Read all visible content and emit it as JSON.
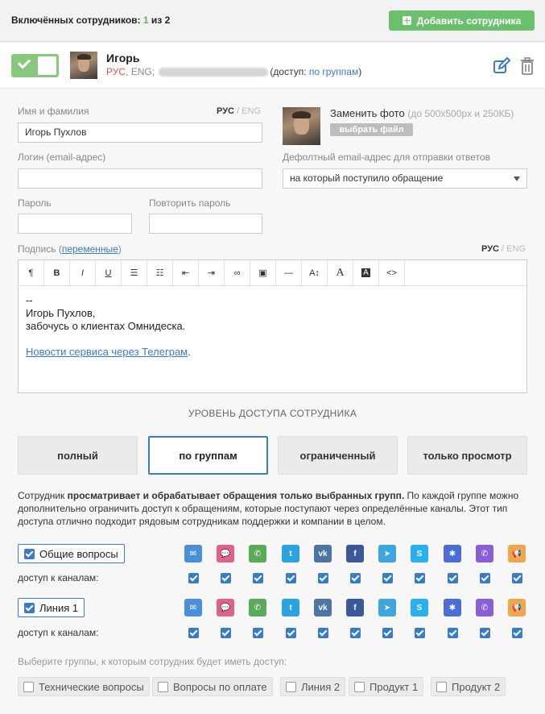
{
  "header": {
    "count_label": "Включённых сотрудников:",
    "count_active": "1",
    "count_sep": "из",
    "count_total": "2",
    "add_button": "Добавить сотрудника"
  },
  "employee": {
    "name": "Игорь",
    "lang_ru": "РУС",
    "lang_en": "ENG;",
    "access_prefix": "(доступ:",
    "access_value": "по группам",
    "access_suffix": ")"
  },
  "form": {
    "name_label": "Имя и фамилия",
    "name_value": "Игорь Пухлов",
    "lang_ru": "РУС",
    "lang_sep": "/",
    "lang_en": "ENG",
    "photo_label": "Заменить фото",
    "photo_hint": "(до 500x500px и 250КБ)",
    "photo_button": "выбрать файл",
    "login_label": "Логин (email-адрес)",
    "default_email_label": "Дефолтный email-адрес для отправки ответов",
    "default_email_value": "на который поступило обращение",
    "password_label": "Пароль",
    "password_repeat_label": "Повторить пароль",
    "signature_label": "Подпись (",
    "signature_link": "переменные",
    "signature_label_end": ")",
    "signature_lines": [
      "--",
      "Игорь Пухлов,",
      "забочусь о клиентах Омнидеска."
    ],
    "signature_news_link": "Новости сервиса через Телеграм",
    "signature_news_dot": "."
  },
  "toolbar": [
    {
      "icon": "paragraph-icon",
      "glyph": "¶"
    },
    {
      "icon": "bold-icon",
      "glyph": "B"
    },
    {
      "icon": "italic-icon",
      "glyph": "I"
    },
    {
      "icon": "underline-icon",
      "glyph": "U"
    },
    {
      "icon": "bullet-list-icon",
      "glyph": "☰"
    },
    {
      "icon": "numbered-list-icon",
      "glyph": "☷"
    },
    {
      "icon": "outdent-icon",
      "glyph": "⇤"
    },
    {
      "icon": "indent-icon",
      "glyph": "⇥"
    },
    {
      "icon": "link-icon",
      "glyph": "∞"
    },
    {
      "icon": "image-icon",
      "glyph": "▣"
    },
    {
      "icon": "hr-icon",
      "glyph": "—"
    },
    {
      "icon": "font-size-icon",
      "glyph": "A↕"
    },
    {
      "icon": "font-color-icon",
      "glyph": "A"
    },
    {
      "icon": "background-color-icon",
      "glyph": "A"
    },
    {
      "icon": "code-icon",
      "glyph": "<>"
    }
  ],
  "access": {
    "title": "УРОВЕНЬ ДОСТУПА СОТРУДНИКА",
    "levels": [
      "полный",
      "по группам",
      "ограниченный",
      "только просмотр"
    ],
    "active": 1,
    "desc_pre": "Сотрудник ",
    "desc_bold": "просматривает и обрабатывает обращения только выбранных групп.",
    "desc_post": " По каждой группе можно дополнительно ограничить доступ к обращениям, которые поступают через определённые каналы. Этот тип доступа отлично подходит рядовым сотрудникам поддержки и компании в целом."
  },
  "channels": [
    {
      "icon": "email-icon",
      "color": "#4a90d9",
      "glyph": "✉"
    },
    {
      "icon": "chat-icon",
      "color": "#e0628a",
      "glyph": "💬"
    },
    {
      "icon": "phone-icon",
      "color": "#5aaa5a",
      "glyph": "✆"
    },
    {
      "icon": "twitter-icon",
      "color": "#2aa3e0",
      "glyph": "t"
    },
    {
      "icon": "vk-icon",
      "color": "#4c75a3",
      "glyph": "vk"
    },
    {
      "icon": "facebook-icon",
      "color": "#3b5998",
      "glyph": "f"
    },
    {
      "icon": "telegram-icon",
      "color": "#3ea5dd",
      "glyph": "➤"
    },
    {
      "icon": "skype-icon",
      "color": "#2ab0ee",
      "glyph": "S"
    },
    {
      "icon": "widget-icon",
      "color": "#4a6ed6",
      "glyph": "✱"
    },
    {
      "icon": "viber-icon",
      "color": "#8a5fd6",
      "glyph": "✆"
    },
    {
      "icon": "megaphone-icon",
      "color": "#f0a74c",
      "glyph": "📢"
    }
  ],
  "groups": [
    {
      "name": "Общие вопросы",
      "channels_label": "доступ к каналам:"
    },
    {
      "name": "Линия 1",
      "channels_label": "доступ к каналам:"
    }
  ],
  "pick": {
    "label": "Выберите группы, к которым сотрудник будет иметь доступ:",
    "options": [
      "Технические вопросы",
      "Вопросы по оплате",
      "Линия 2",
      "Продукт 1",
      "Продукт 2"
    ]
  }
}
